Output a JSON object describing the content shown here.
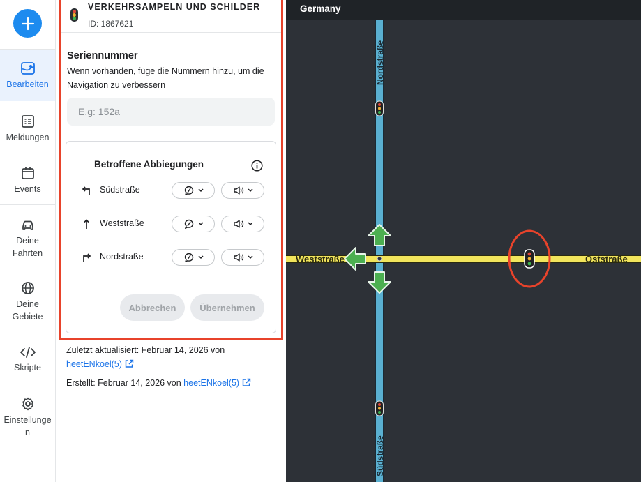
{
  "rail": {
    "items": [
      {
        "label": "Bearbeiten"
      },
      {
        "label": "Meldungen"
      },
      {
        "label": "Events"
      },
      {
        "label_line1": "Deine",
        "label_line2": "Fahrten"
      },
      {
        "label_line1": "Deine",
        "label_line2": "Gebiete"
      },
      {
        "label": "Skripte"
      },
      {
        "label_line1": "Einstellunge",
        "label_line2": "n"
      }
    ]
  },
  "panel": {
    "header": {
      "title": "VERKEHRSAMPELN UND SCHILDER",
      "id": "ID: 1867621"
    },
    "serial": {
      "title": "Seriennummer",
      "description": "Wenn vorhanden, füge die Nummern hinzu, um die Navigation zu verbessern",
      "placeholder": "E.g: 152a",
      "value": ""
    },
    "turns": {
      "title": "Betroffene Abbiegungen",
      "rows": [
        {
          "direction": "left",
          "street": "Südstraße"
        },
        {
          "direction": "straight",
          "street": "Weststraße"
        },
        {
          "direction": "right",
          "street": "Nordstraße"
        }
      ],
      "cancel_label": "Abbrechen",
      "apply_label": "Übernehmen"
    },
    "meta": {
      "updated_prefix": "Zuletzt aktualisiert: Februar 14, 2026 von",
      "updated_user": "heetENkoel(5)",
      "created_prefix": "Erstellt: Februar 14, 2026 von",
      "created_user": "heetENkoel(5)"
    }
  },
  "map": {
    "country": "Germany",
    "streets": {
      "north": "Nordstraße",
      "south": "Südstraße",
      "west": "Weststraße",
      "east": "Oststraße"
    }
  },
  "colors": {
    "accent": "#1a73e8",
    "highlight": "#e8432b",
    "road_vertical": "#5ab0d1",
    "road_horizontal": "#f2e55c",
    "arrow": "#4caf50"
  }
}
